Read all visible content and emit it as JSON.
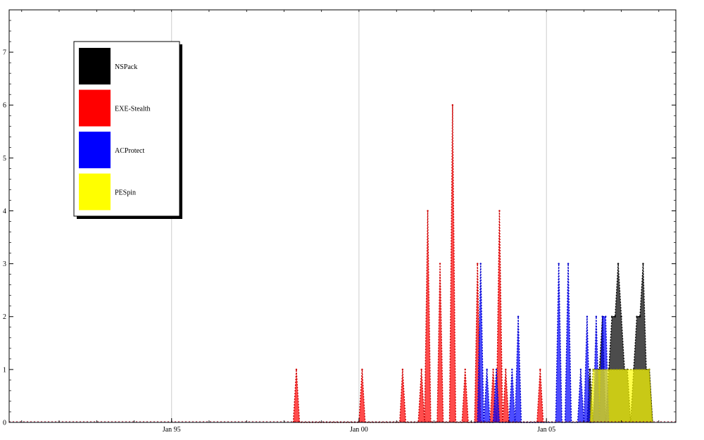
{
  "chart_data": {
    "type": "area",
    "title": "",
    "xlabel": "",
    "ylabel": "",
    "xlim": [
      "1990-09-01",
      "2008-06-15"
    ],
    "ylim": [
      0,
      7.8
    ],
    "grid": "vertical lines at x ticks",
    "legend_position": "top-left",
    "x_ticks": [
      {
        "date": "1995-01-01",
        "label": "Jan 95"
      },
      {
        "date": "2000-01-01",
        "label": "Jan 00"
      },
      {
        "date": "2005-01-01",
        "label": "Jan 05"
      }
    ],
    "y_ticks": [
      0,
      1,
      2,
      3,
      4,
      5,
      6,
      7
    ],
    "series": [
      {
        "name": "NSPack",
        "color": "#000000",
        "stroke": "#000000",
        "points": [
          [
            "2006-02-01",
            0
          ],
          [
            "2006-03-01",
            1
          ],
          [
            "2006-04-01",
            0
          ],
          [
            "2006-05-01",
            1
          ],
          [
            "2006-06-01",
            1
          ],
          [
            "2006-07-01",
            2
          ],
          [
            "2006-08-01",
            0
          ],
          [
            "2006-09-01",
            1
          ],
          [
            "2006-10-01",
            2
          ],
          [
            "2006-11-01",
            2
          ],
          [
            "2006-12-01",
            3
          ],
          [
            "2007-01-01",
            2
          ],
          [
            "2007-02-01",
            1
          ],
          [
            "2007-03-01",
            1
          ],
          [
            "2007-04-01",
            0
          ],
          [
            "2007-05-01",
            1
          ],
          [
            "2007-06-01",
            2
          ],
          [
            "2007-07-01",
            2
          ],
          [
            "2007-08-01",
            3
          ],
          [
            "2007-09-01",
            1
          ],
          [
            "2007-10-01",
            1
          ],
          [
            "2007-11-01",
            0
          ]
        ]
      },
      {
        "name": "EXE-Stealth",
        "color": "#ff0000",
        "stroke": "#cc0000",
        "points": [
          [
            "1998-04-01",
            0
          ],
          [
            "1998-05-01",
            1
          ],
          [
            "1998-06-01",
            0
          ],
          [
            "1999-12-01",
            0
          ],
          [
            "2000-01-01",
            0
          ],
          [
            "2000-02-01",
            1
          ],
          [
            "2000-03-01",
            0
          ],
          [
            "2001-02-01",
            0
          ],
          [
            "2001-03-01",
            1
          ],
          [
            "2001-04-01",
            0
          ],
          [
            "2001-08-01",
            0
          ],
          [
            "2001-09-01",
            1
          ],
          [
            "2001-10-01",
            0
          ],
          [
            "2001-11-01",
            4
          ],
          [
            "2001-12-01",
            0
          ],
          [
            "2002-02-01",
            0
          ],
          [
            "2002-03-01",
            3
          ],
          [
            "2002-04-01",
            0
          ],
          [
            "2002-06-01",
            0
          ],
          [
            "2002-07-01",
            6
          ],
          [
            "2002-08-01",
            0
          ],
          [
            "2002-10-01",
            0
          ],
          [
            "2002-11-01",
            1
          ],
          [
            "2002-12-01",
            0
          ],
          [
            "2003-02-01",
            0
          ],
          [
            "2003-03-01",
            3
          ],
          [
            "2003-04-01",
            0
          ],
          [
            "2003-07-01",
            0
          ],
          [
            "2003-08-01",
            1
          ],
          [
            "2003-09-01",
            0
          ],
          [
            "2003-10-01",
            4
          ],
          [
            "2003-11-01",
            0
          ],
          [
            "2003-12-01",
            1
          ],
          [
            "2004-01-01",
            0
          ],
          [
            "2004-10-01",
            0
          ],
          [
            "2004-11-01",
            1
          ],
          [
            "2004-12-01",
            0
          ]
        ]
      },
      {
        "name": "ACProtect",
        "color": "#0000ff",
        "stroke": "#0000cc",
        "points": [
          [
            "2003-02-01",
            0
          ],
          [
            "2003-03-01",
            0
          ],
          [
            "2003-04-01",
            3
          ],
          [
            "2003-05-01",
            0
          ],
          [
            "2003-06-01",
            1
          ],
          [
            "2003-07-01",
            0
          ],
          [
            "2003-08-01",
            0
          ],
          [
            "2003-09-01",
            1
          ],
          [
            "2003-10-01",
            0
          ],
          [
            "2004-01-01",
            0
          ],
          [
            "2004-02-01",
            1
          ],
          [
            "2004-03-01",
            0
          ],
          [
            "2004-04-01",
            2
          ],
          [
            "2004-05-01",
            0
          ],
          [
            "2005-04-01",
            0
          ],
          [
            "2005-05-01",
            3
          ],
          [
            "2005-06-01",
            0
          ],
          [
            "2005-07-01",
            0
          ],
          [
            "2005-08-01",
            3
          ],
          [
            "2005-09-01",
            0
          ],
          [
            "2005-11-01",
            0
          ],
          [
            "2005-12-01",
            1
          ],
          [
            "2006-01-01",
            0
          ],
          [
            "2006-02-01",
            2
          ],
          [
            "2006-03-01",
            0
          ],
          [
            "2006-04-01",
            0
          ],
          [
            "2006-05-01",
            2
          ],
          [
            "2006-06-01",
            0
          ],
          [
            "2006-07-01",
            2
          ],
          [
            "2006-08-01",
            2
          ],
          [
            "2006-09-01",
            0
          ]
        ]
      },
      {
        "name": "PESpin",
        "color": "#ffff00",
        "stroke": "#999900",
        "points": [
          [
            "2006-03-01",
            0
          ],
          [
            "2006-04-01",
            1
          ],
          [
            "2007-10-01",
            1
          ],
          [
            "2007-11-01",
            0
          ]
        ]
      }
    ]
  }
}
